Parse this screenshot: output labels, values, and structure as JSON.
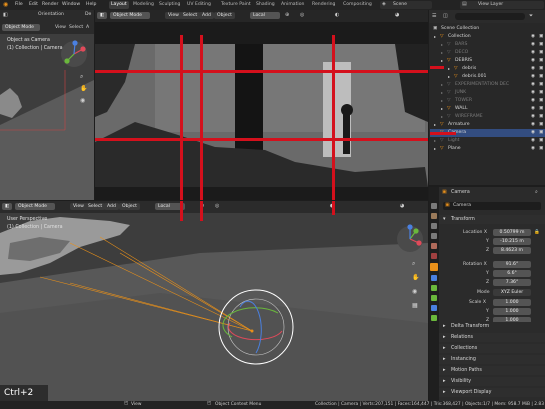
{
  "topbar": {
    "menu": [
      "File",
      "Edit",
      "Render",
      "Window",
      "Help"
    ],
    "workspaces": [
      "Layout",
      "Modeling",
      "Sculpting",
      "UV Editing",
      "Texture Paint",
      "Shading",
      "Animation",
      "Rendering",
      "Compositing"
    ],
    "active_workspace": "Layout",
    "scene": "Scene",
    "view_layer": "View Layer",
    "orientation_label": "Orientation",
    "de_label": "De"
  },
  "left_panel": {
    "mode": "Object Mode",
    "menu": [
      "View",
      "Select",
      "A"
    ],
    "view_title": "Object as Camera",
    "collection_info": "(1) Collection | Camera"
  },
  "camera_view": {
    "mode": "Object Mode",
    "menu": [
      "View",
      "Select",
      "Add",
      "Object"
    ],
    "transform": "Local"
  },
  "viewport3d": {
    "mode": "Object Mode",
    "menu": [
      "View",
      "Select",
      "Add",
      "Object"
    ],
    "transform": "Local",
    "view_title": "User Perspective",
    "collection_info": "(1) Collection | Camera",
    "shortcut_overlay": "Ctrl+2"
  },
  "outliner": {
    "title": "Scene Collection",
    "rows": [
      {
        "label": "Collection",
        "indent": 1,
        "state": "normal"
      },
      {
        "label": "BARS",
        "indent": 2,
        "state": "dim"
      },
      {
        "label": "DECO",
        "indent": 2,
        "state": "dim"
      },
      {
        "label": "DEBRIS",
        "indent": 2,
        "state": "normal"
      },
      {
        "label": "debris",
        "indent": 3,
        "state": "normal"
      },
      {
        "label": "debris.001",
        "indent": 3,
        "state": "normal"
      },
      {
        "label": "EXPERIMENTATION DEC",
        "indent": 2,
        "state": "dim"
      },
      {
        "label": "JUNK",
        "indent": 2,
        "state": "dim"
      },
      {
        "label": "TOWER",
        "indent": 2,
        "state": "dim"
      },
      {
        "label": "WALL",
        "indent": 2,
        "state": "normal"
      },
      {
        "label": "WIREFRAME",
        "indent": 2,
        "state": "dim"
      },
      {
        "label": "Armature",
        "indent": 1,
        "state": "normal"
      },
      {
        "label": "Camera",
        "indent": 1,
        "state": "selected"
      },
      {
        "label": "Light",
        "indent": 1,
        "state": "dim"
      },
      {
        "label": "Plane",
        "indent": 1,
        "state": "normal"
      }
    ]
  },
  "properties": {
    "object_name": "Camera",
    "name_field": "Camera",
    "transform_header": "Transform",
    "location": {
      "label": "Location X",
      "x": "0.50799 m",
      "y": "-10.215 m",
      "z": "8.4623 m"
    },
    "rotation": {
      "label": "Rotation X",
      "x": "91.6°",
      "y": "6.6°",
      "z": "7.36°"
    },
    "mode": {
      "label": "Mode",
      "value": "XYZ Euler"
    },
    "scale": {
      "label": "Scale X",
      "x": "1.000",
      "y": "1.000",
      "z": "1.000"
    },
    "axis_y": "Y",
    "axis_z": "Z",
    "sections": [
      "Delta Transform",
      "Relations",
      "Collections",
      "Instancing",
      "Motion Paths",
      "Visibility",
      "Viewport Display"
    ]
  },
  "statusbar": {
    "left": "View",
    "middle": "Object Context Menu",
    "right": "Collection | Camera | Verts:207,151 | Faces:164,447 | Tris:368,427 | Objects:1/7 | Mem: 958.7 MiB | 2.83"
  },
  "colors": {
    "accent_blue": "#334d80",
    "annotation_red": "#d4101c",
    "selected_orange": "#e8901a"
  }
}
